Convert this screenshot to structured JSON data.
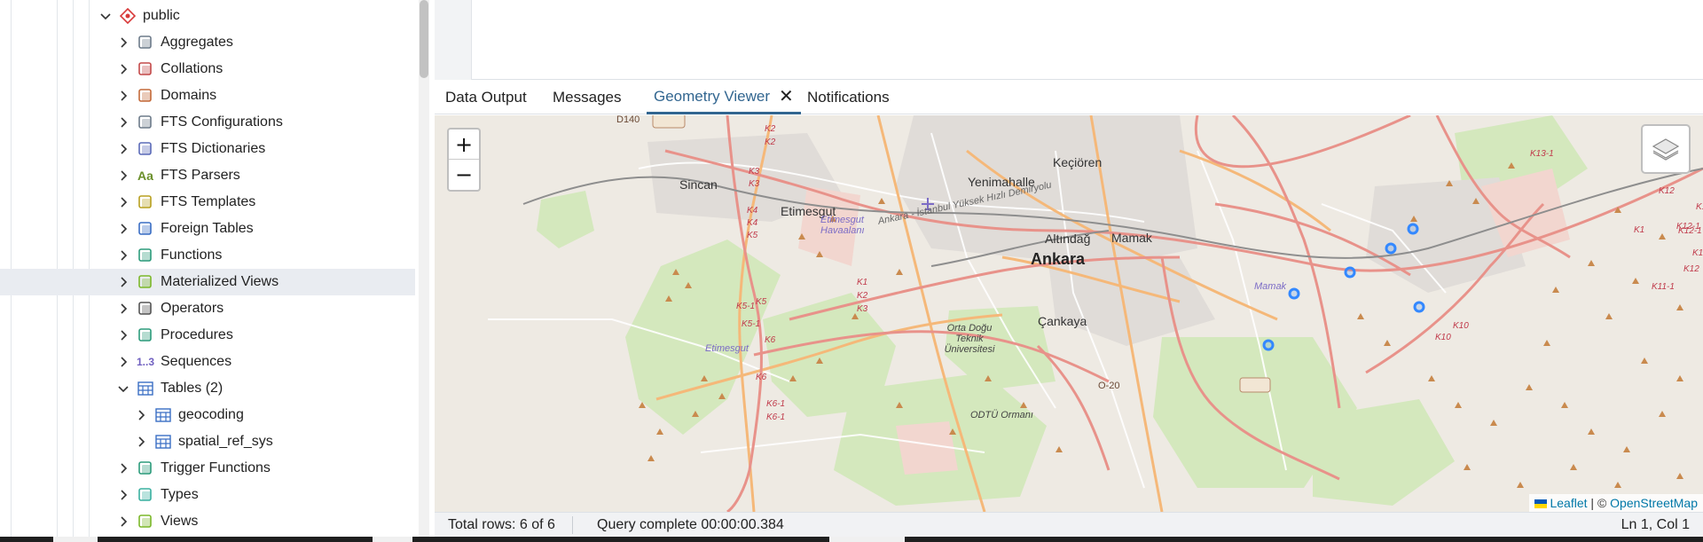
{
  "tree": {
    "items": [
      {
        "label": "public",
        "icon": "schema-icon",
        "expanded": true
      },
      {
        "label": "Aggregates",
        "icon": "aggregate-icon"
      },
      {
        "label": "Collations",
        "icon": "collation-icon"
      },
      {
        "label": "Domains",
        "icon": "domain-icon"
      },
      {
        "label": "FTS Configurations",
        "icon": "fts-configuration-icon"
      },
      {
        "label": "FTS Dictionaries",
        "icon": "fts-dictionary-icon"
      },
      {
        "label": "FTS Parsers",
        "icon": "fts-parser-icon"
      },
      {
        "label": "FTS Templates",
        "icon": "fts-template-icon"
      },
      {
        "label": "Foreign Tables",
        "icon": "foreign-table-icon"
      },
      {
        "label": "Functions",
        "icon": "function-icon"
      },
      {
        "label": "Materialized Views",
        "icon": "materialized-view-icon",
        "selected": true
      },
      {
        "label": "Operators",
        "icon": "operator-icon"
      },
      {
        "label": "Procedures",
        "icon": "procedure-icon"
      },
      {
        "label": "Sequences",
        "icon": "sequence-icon",
        "glyph": "1..3"
      },
      {
        "label": "Tables (2)",
        "icon": "table-icon",
        "expanded": true
      },
      {
        "label": "geocoding",
        "icon": "table-icon"
      },
      {
        "label": "spatial_ref_sys",
        "icon": "table-icon"
      },
      {
        "label": "Trigger Functions",
        "icon": "trigger-function-icon"
      },
      {
        "label": "Types",
        "icon": "type-icon"
      },
      {
        "label": "Views",
        "icon": "view-icon"
      }
    ]
  },
  "tabs": {
    "data_output": "Data Output",
    "messages": "Messages",
    "geometry_viewer": "Geometry Viewer",
    "notifications": "Notifications",
    "close_glyph": "✕"
  },
  "map": {
    "zoom_in": "+",
    "zoom_out": "−",
    "labels": {
      "sincan": "Sincan",
      "etimesgut": "Etimesgut",
      "kecioren": "Keçiören",
      "yenimahalle": "Yenimahalle",
      "altindag": "Altındağ",
      "ankara": "Ankara",
      "mamak": "Mamak",
      "cankaya": "Çankaya",
      "airport": "Etimesgut Havaalanı",
      "odtu": "Orta Doğu Teknik Üniversitesi",
      "odtu_ormani": "ODTÜ Ormanı",
      "rail": "Ankara - İstanbul Yüksek Hızlı Demiryolu",
      "d140": "D140",
      "o20": "O-20",
      "mamak_small": "Mamak",
      "etimesgut_small": "Etimesgut"
    },
    "route_labels": [
      "K2",
      "K2",
      "K3",
      "K3",
      "K4",
      "K4",
      "K5",
      "K5",
      "K5-1",
      "K5-1",
      "K6",
      "K6",
      "K6-1",
      "K6-1",
      "K1",
      "K2",
      "K3",
      "K10",
      "K10",
      "K11-1",
      "K12",
      "K12-1",
      "K12-1",
      "K12-1",
      "K13-1",
      "K1",
      "K12",
      "K12"
    ],
    "attribution": {
      "leaflet": "Leaflet",
      "separator": " | © ",
      "osm": "OpenStreetMap"
    },
    "colors": {
      "background": "#eeeae3",
      "park": "#cfe6b4",
      "motorway": "#e8928a",
      "trunk": "#f5b879",
      "marker": "#3388ff"
    }
  },
  "status": {
    "rows": "Total rows: 6 of 6",
    "query": "Query complete 00:00:00.384",
    "cursor": "Ln 1, Col 1"
  }
}
